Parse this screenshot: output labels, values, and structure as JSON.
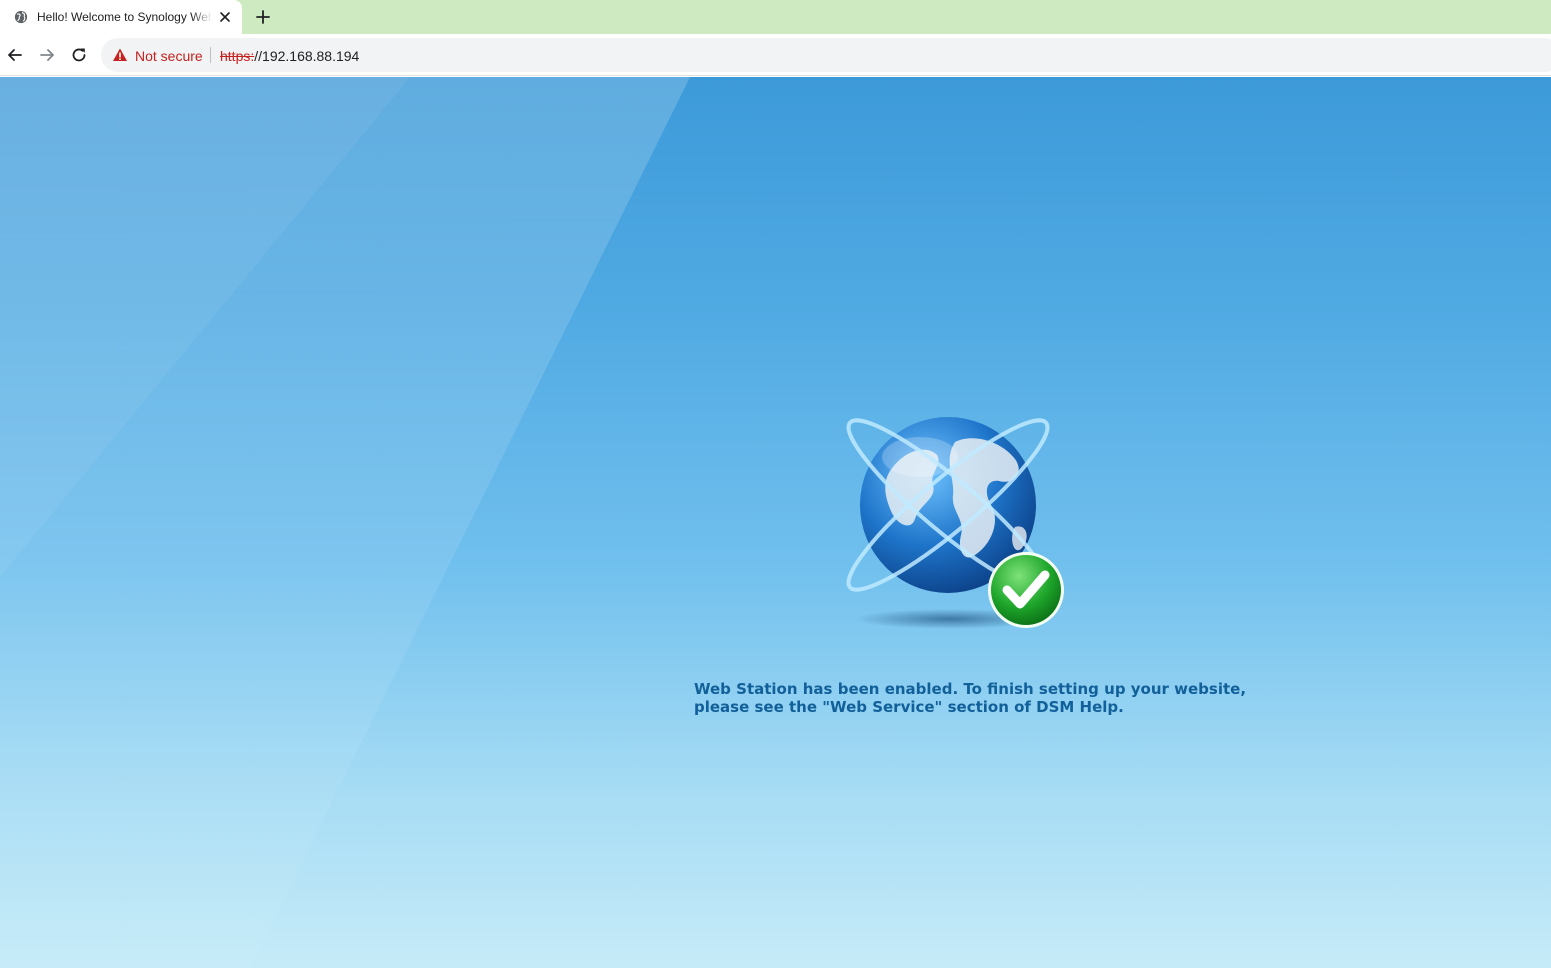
{
  "browser": {
    "tab": {
      "title": "Hello! Welcome to Synology Web Station!",
      "favicon": "globe-icon",
      "close_icon": "close-icon"
    },
    "new_tab_icon": "plus-icon",
    "nav": {
      "back_icon": "arrow-left-icon",
      "forward_icon": "arrow-right-icon",
      "reload_icon": "reload-icon"
    },
    "omnibox": {
      "warning_icon": "warning-triangle-icon",
      "security_label": "Not secure",
      "url_scheme": "https:",
      "url_rest": "//192.168.88.194"
    },
    "colors": {
      "tabstrip": "#cdeac0",
      "not_secure": "#c5221f"
    }
  },
  "page": {
    "illustration": "globe-with-checkmark-icon",
    "message_line1": "Web Station has been enabled. To finish setting up your website,",
    "message_line2": "please see the \"Web Service\" section of DSM Help.",
    "colors": {
      "message_text": "#12609a",
      "background_top": "#3d9ad9",
      "background_bottom": "#c6ebf8"
    }
  }
}
